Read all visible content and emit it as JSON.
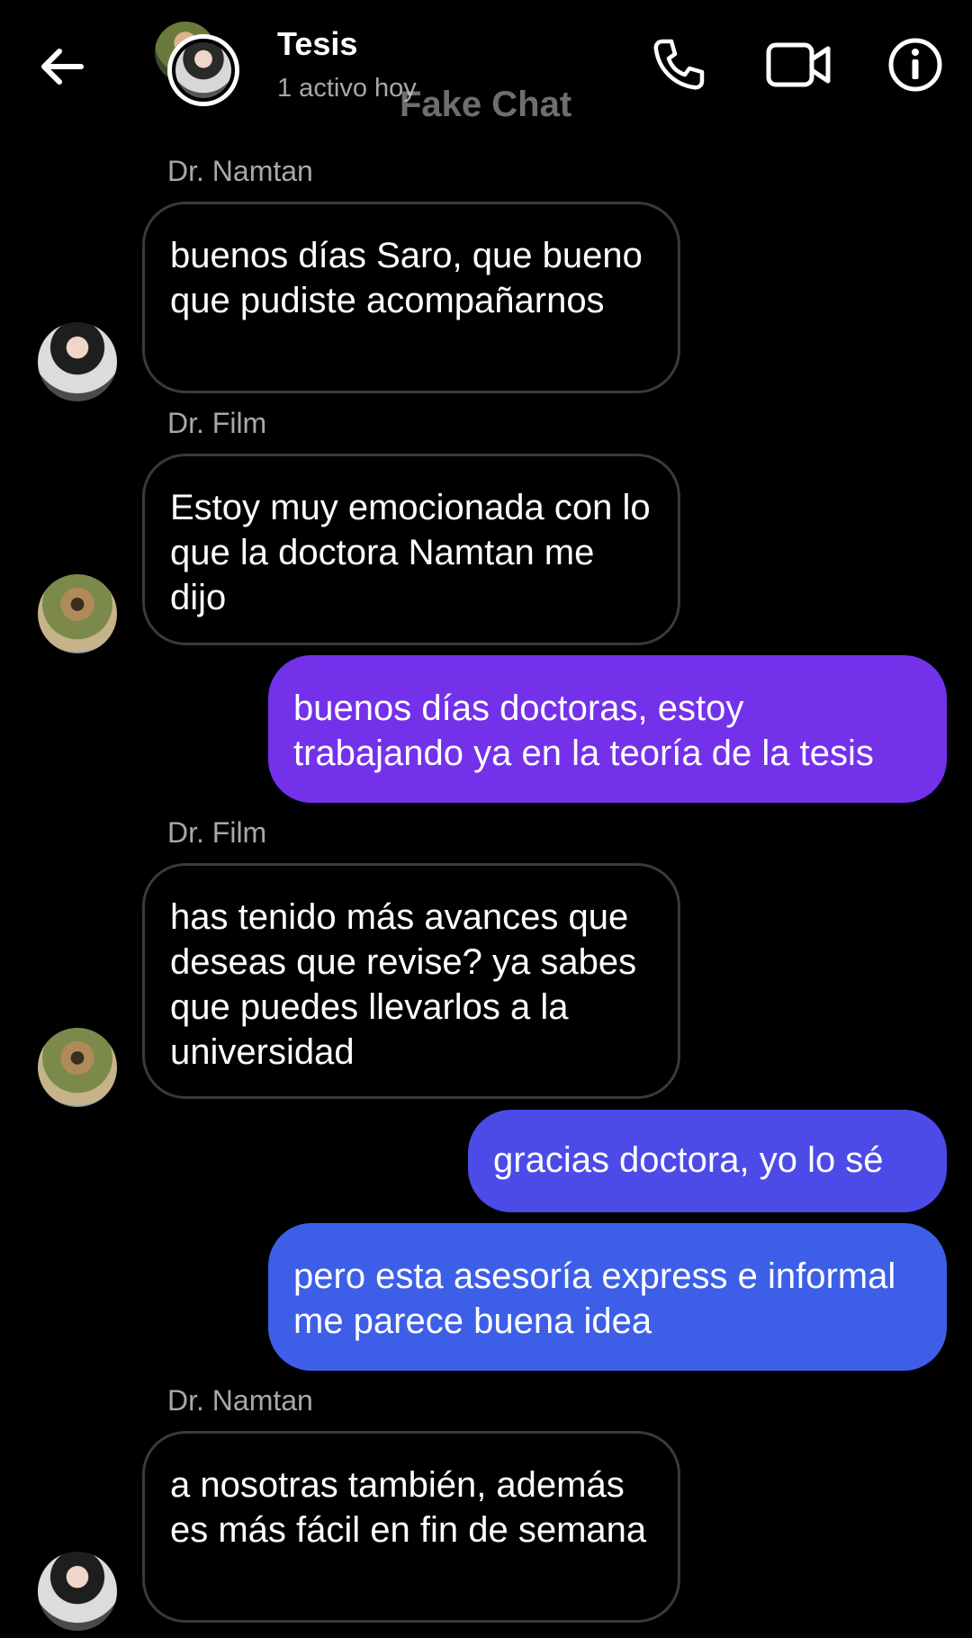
{
  "header": {
    "title": "Tesis",
    "status": "1 activo hoy",
    "watermark": "Fake Chat"
  },
  "colors": {
    "background": "#000000",
    "sent_top": "#7431ea",
    "sent_bottom": "#3d5fe8",
    "received_border": "#3a3a3a"
  },
  "messages": [
    {
      "type": "received",
      "sender": "Dr. Namtan",
      "text": "buenos días Saro, que bueno que pudiste acompañarnos"
    },
    {
      "type": "received",
      "sender": "Dr. Film",
      "text": "Estoy muy emocionada con lo que la doctora Namtan me dijo"
    },
    {
      "type": "sent",
      "text": "buenos días doctoras, estoy trabajando ya en la teoría de la tesis"
    },
    {
      "type": "received",
      "sender": "Dr. Film",
      "text": "has tenido más avances que deseas que revise? ya sabes que puedes llevarlos a la universidad"
    },
    {
      "type": "sent",
      "text": "gracias doctora, yo lo sé"
    },
    {
      "type": "sent",
      "text": "pero esta asesoría express e informal me parece buena idea"
    },
    {
      "type": "received",
      "sender": "Dr. Namtan",
      "text": "a nosotras también, además es más fácil en fin de semana"
    }
  ]
}
